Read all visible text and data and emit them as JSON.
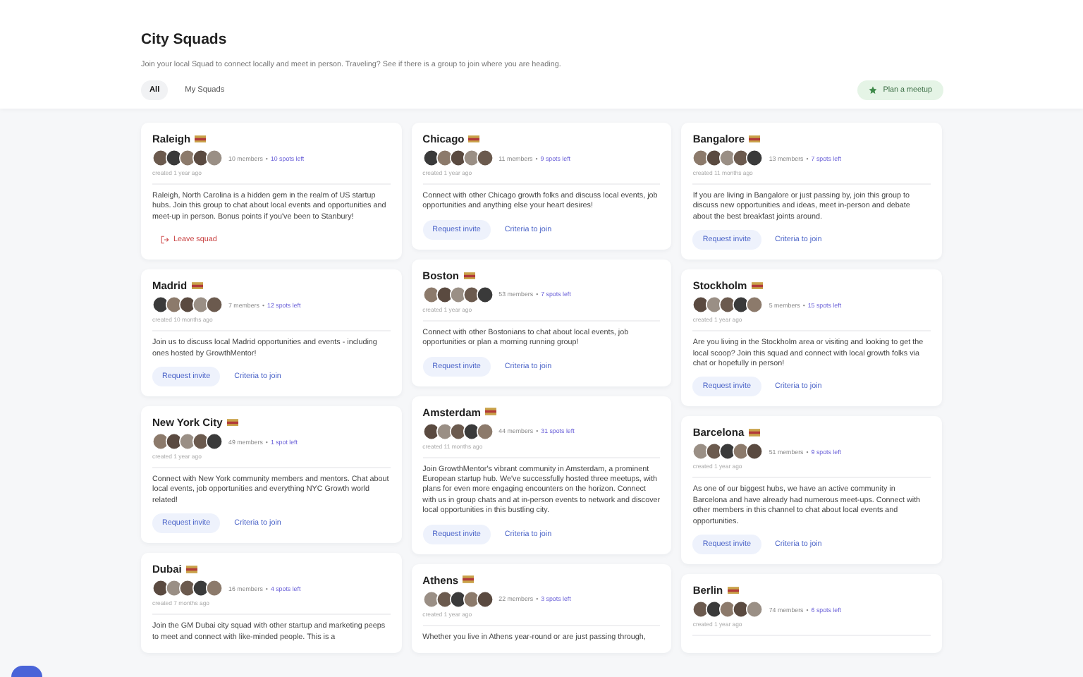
{
  "header": {
    "title": "City Squads",
    "subtitle": "Join your local Squad to connect locally and meet in person. Traveling? See if there is a group to join where you are heading.",
    "tabs": [
      {
        "label": "All",
        "selected": true
      },
      {
        "label": "My Squads",
        "selected": false
      }
    ],
    "action": "Plan a meetup"
  },
  "columns": [
    {
      "cards": [
        {
          "city": "Raleigh",
          "members": "10 members",
          "separator": "•",
          "spots": "10 spots left",
          "created": "created 1 year ago",
          "description": "Raleigh, North Carolina is a hidden gem in the realm of US startup hubs. Join this group to chat about local events and opportunities and meet-up in person. Bonus points if you've been to Stanbury!",
          "actions": [
            {
              "kind": "leave",
              "label": "Leave squad"
            }
          ]
        },
        {
          "city": "Madrid",
          "members": "7 members",
          "separator": "•",
          "spots": "12 spots left",
          "created": "created 10 months ago",
          "description": "Join us to discuss local Madrid opportunities and events - including ones hosted by GrowthMentor!",
          "actions": [
            {
              "kind": "request",
              "label": "Request invite"
            },
            {
              "kind": "criteria",
              "label": "Criteria to join"
            }
          ]
        },
        {
          "city": "New York City",
          "members": "49 members",
          "separator": "•",
          "spots": "1 spot left",
          "created": "created 1 year ago",
          "description": "Connect with New York community members and mentors. Chat about local events, job opportunities and everything NYC Growth world related!",
          "actions": [
            {
              "kind": "request",
              "label": "Request invite"
            },
            {
              "kind": "criteria",
              "label": "Criteria to join"
            }
          ]
        },
        {
          "city": "Dubai",
          "members": "16 members",
          "separator": "•",
          "spots": "4 spots left",
          "created": "created 7 months ago",
          "description": "Join the GM Dubai city squad with other startup and marketing peeps to meet and connect with like-minded people. This is a"
        }
      ]
    },
    {
      "cards": [
        {
          "city": "Chicago",
          "members": "11 members",
          "separator": "•",
          "spots": "9 spots left",
          "created": "created 1 year ago",
          "description": "Connect with other Chicago growth folks and discuss local events, job opportunities and anything else your heart desires!",
          "actions": [
            {
              "kind": "request",
              "label": "Request invite"
            },
            {
              "kind": "criteria",
              "label": "Criteria to join"
            }
          ]
        },
        {
          "city": "Boston",
          "members": "53 members",
          "separator": "•",
          "spots": "7 spots left",
          "created": "created 1 year ago",
          "description": "Connect with other Bostonians to chat about local events, job opportunities or plan a morning running group!",
          "actions": [
            {
              "kind": "request",
              "label": "Request invite"
            },
            {
              "kind": "criteria",
              "label": "Criteria to join"
            }
          ]
        },
        {
          "city": "Amsterdam",
          "members": "44 members",
          "separator": "•",
          "spots": "31 spots left",
          "created": "created 11 months ago",
          "description": "Join GrowthMentor's vibrant community in Amsterdam, a prominent European startup hub. We've successfully hosted three meetups, with plans for even more engaging encounters on the horizon. Connect with us in group chats and at in-person events to network and discover local opportunities in this bustling city.",
          "actions": [
            {
              "kind": "request",
              "label": "Request invite"
            },
            {
              "kind": "criteria",
              "label": "Criteria to join"
            }
          ]
        },
        {
          "city": "Athens",
          "members": "22 members",
          "separator": "•",
          "spots": "3 spots left",
          "created": "created 1 year ago",
          "description": "Whether you live in Athens year-round or are just passing through,"
        }
      ]
    },
    {
      "cards": [
        {
          "city": "Bangalore",
          "members": "13 members",
          "separator": "•",
          "spots": "7 spots left",
          "created": "created 11 months ago",
          "description": "If you are living in Bangalore or just passing by, join this group to discuss new opportunities and ideas, meet in-person and debate about the best breakfast joints around.",
          "actions": [
            {
              "kind": "request",
              "label": "Request invite"
            },
            {
              "kind": "criteria",
              "label": "Criteria to join"
            }
          ]
        },
        {
          "city": "Stockholm",
          "members": "5 members",
          "separator": "•",
          "spots": "15 spots left",
          "created": "created 1 year ago",
          "description": "Are you living in the Stockholm area or visiting and looking to get the local scoop? Join this squad and connect with local growth folks via chat or hopefully in person!",
          "actions": [
            {
              "kind": "request",
              "label": "Request invite"
            },
            {
              "kind": "criteria",
              "label": "Criteria to join"
            }
          ]
        },
        {
          "city": "Barcelona",
          "members": "51 members",
          "separator": "•",
          "spots": "9 spots left",
          "created": "created 1 year ago",
          "description": "As one of our biggest hubs, we have an active community in Barcelona and have already had numerous meet-ups. Connect with other members in this channel to chat about local events and opportunities.",
          "actions": [
            {
              "kind": "request",
              "label": "Request invite"
            },
            {
              "kind": "criteria",
              "label": "Criteria to join"
            }
          ]
        },
        {
          "city": "Berlin",
          "members": "74 members",
          "separator": "•",
          "spots": "6 spots left",
          "created": "created 1 year ago"
        }
      ]
    }
  ]
}
